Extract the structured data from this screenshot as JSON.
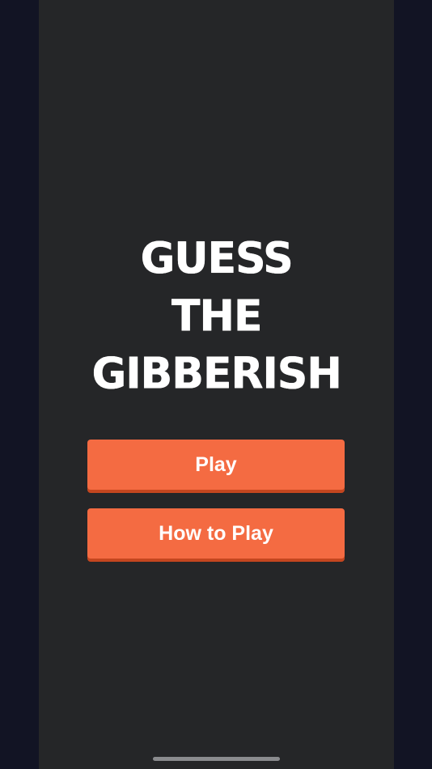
{
  "app": {
    "title_lines": [
      "GUESS",
      "THE",
      "GIBBERISH"
    ]
  },
  "menu": {
    "play_label": "Play",
    "how_to_play_label": "How to Play"
  },
  "colors": {
    "outer_background": "#121424",
    "panel_background": "#252628",
    "button": "#f46b42",
    "button_shadow": "#c4461f",
    "title_text": "#ffffff"
  }
}
